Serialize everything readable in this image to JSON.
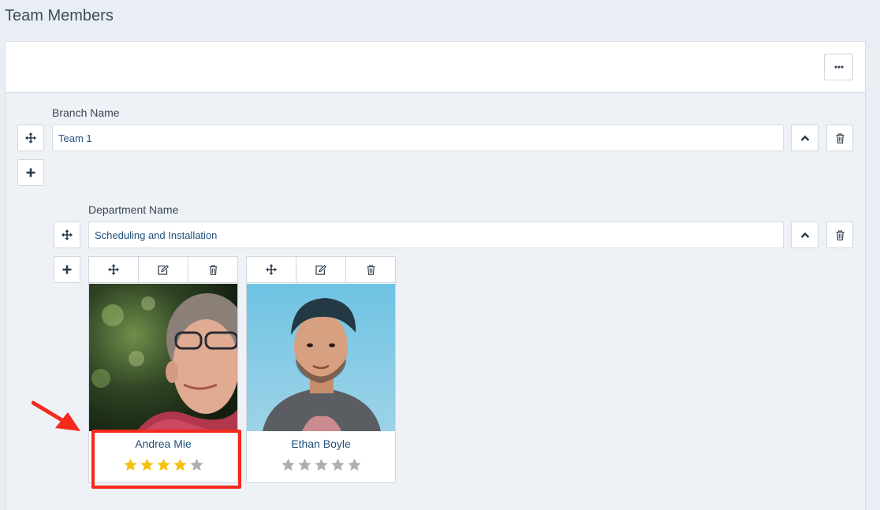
{
  "page": {
    "title": "Team Members"
  },
  "toolbar": {
    "more_label": "···"
  },
  "branch": {
    "label": "Branch Name",
    "value": "Team 1"
  },
  "department": {
    "label": "Department Name",
    "value": "Scheduling and Installation"
  },
  "members": [
    {
      "name": "Andrea Mie",
      "rating": 4,
      "max_rating": 5
    },
    {
      "name": "Ethan Boyle",
      "rating": 0,
      "max_rating": 5
    }
  ],
  "colors": {
    "star_filled": "#f4c20d",
    "star_empty": "#b3adb2",
    "highlight": "#f5291c",
    "accent_text": "#1f4f7a"
  },
  "icons": {
    "move": "move-icon",
    "add": "plus-icon",
    "collapse": "chevron-up-icon",
    "delete": "trash-icon",
    "edit": "edit-icon",
    "more": "ellipsis-icon"
  }
}
